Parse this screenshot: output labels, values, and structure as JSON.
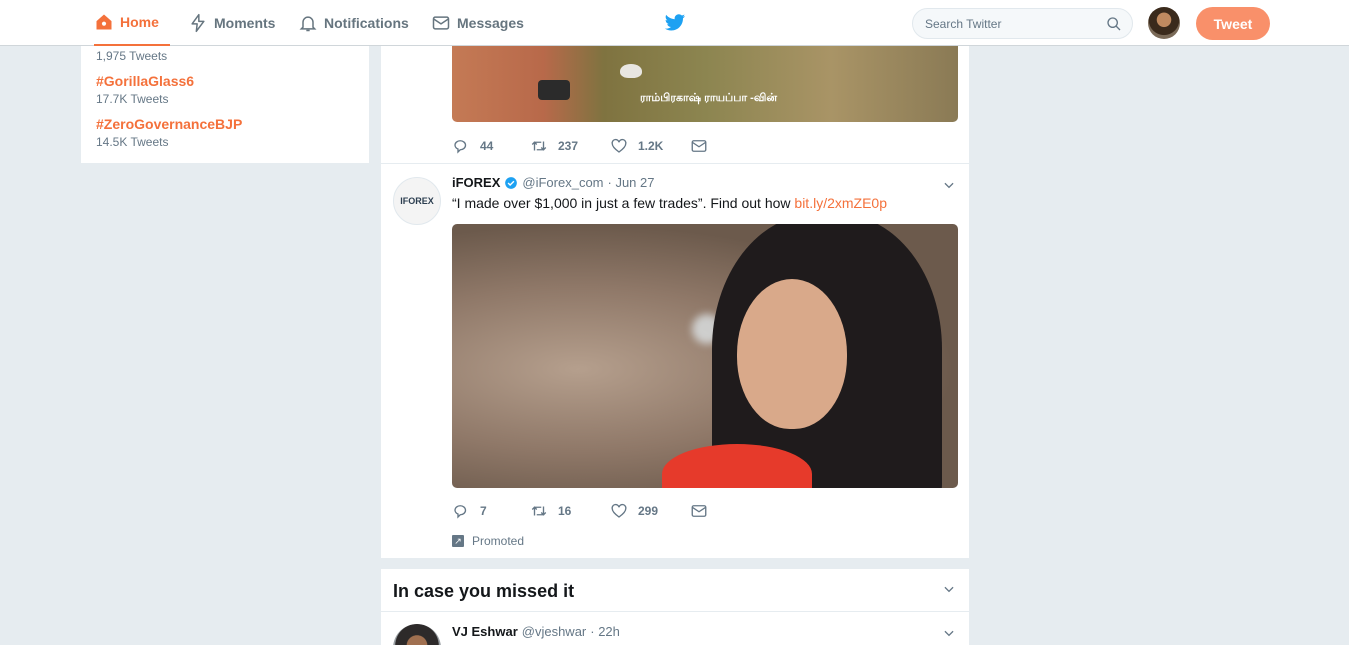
{
  "nav": {
    "home": "Home",
    "moments": "Moments",
    "notifications": "Notifications",
    "messages": "Messages",
    "search_placeholder": "Search Twitter",
    "tweet_button": "Tweet"
  },
  "trends": [
    {
      "tag": "",
      "count": "1,975 Tweets"
    },
    {
      "tag": "#GorillaGlass6",
      "count": "17.7K Tweets"
    },
    {
      "tag": "#ZeroGovernanceBJP",
      "count": "14.5K Tweets"
    }
  ],
  "prev_tweet": {
    "image_caption": "ராம்பிரகாஷ் ராயப்பா -வின்",
    "replies": "44",
    "retweets": "237",
    "likes": "1.2K"
  },
  "promoted_tweet": {
    "avatar_text": "IFOREX",
    "name": "iFOREX",
    "handle": "@iForex_com",
    "date": "· Jun 27",
    "text": "“I made over $1,000 in just a few trades”. Find out how ",
    "link": "bit.ly/2xmZE0p",
    "replies": "7",
    "retweets": "16",
    "likes": "299",
    "promoted_label": "Promoted"
  },
  "icymi": {
    "title": "In case you missed it",
    "name": "VJ Eshwar",
    "handle": "@vjeshwar",
    "time": "· 22h"
  },
  "colors": {
    "accent": "#f4713b",
    "tweet_button": "#f9906a",
    "twitter_blue": "#1da1f2"
  }
}
